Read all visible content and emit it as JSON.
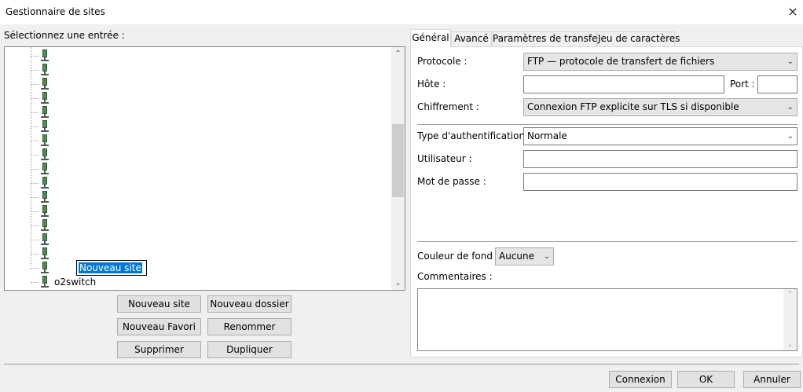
{
  "window": {
    "title": "Gestionnaire de sites",
    "close_icon": "×"
  },
  "left": {
    "select_label": "Sélectionnez une entrée :",
    "sites": [
      {
        "name": "",
        "editing": false
      },
      {
        "name": "",
        "editing": false
      },
      {
        "name": "",
        "editing": false
      },
      {
        "name": "",
        "editing": false
      },
      {
        "name": "",
        "editing": false
      },
      {
        "name": "",
        "editing": false
      },
      {
        "name": "",
        "editing": false
      },
      {
        "name": "",
        "editing": false
      },
      {
        "name": "",
        "editing": false
      },
      {
        "name": "",
        "editing": false
      },
      {
        "name": "",
        "editing": false
      },
      {
        "name": "",
        "editing": false
      },
      {
        "name": "",
        "editing": false
      },
      {
        "name": "",
        "editing": false
      },
      {
        "name": "",
        "editing": false
      },
      {
        "name": "Nouveau site",
        "editing": true
      },
      {
        "name": "o2switch",
        "editing": false
      }
    ],
    "buttons": {
      "new_site": "Nouveau site",
      "new_folder": "Nouveau dossier",
      "new_bookmark": "Nouveau Favori",
      "rename": "Renommer",
      "delete": "Supprimer",
      "duplicate": "Dupliquer"
    }
  },
  "tabs": [
    "Général",
    "Avancé",
    "Paramètres de transfert",
    "Jeu de caractères"
  ],
  "general": {
    "protocol_label": "Protocole :",
    "protocol_value": "FTP — protocole de transfert de fichiers",
    "host_label": "Hôte :",
    "host_value": "",
    "port_label": "Port :",
    "port_value": "",
    "encryption_label": "Chiffrement :",
    "encryption_value": "Connexion FTP explicite sur TLS si disponible",
    "auth_label": "Type d'authentification :",
    "auth_value": "Normale",
    "user_label": "Utilisateur :",
    "user_value": "",
    "password_label": "Mot de passe :",
    "password_value": "",
    "bgcolor_label": "Couleur de fond :",
    "bgcolor_value": "Aucune",
    "comments_label": "Commentaires :",
    "comments_value": ""
  },
  "footer": {
    "connect": "Connexion",
    "ok": "OK",
    "cancel": "Annuler"
  },
  "colors": {
    "selection": "#0078d7",
    "server_icon": "#4e8d52"
  }
}
